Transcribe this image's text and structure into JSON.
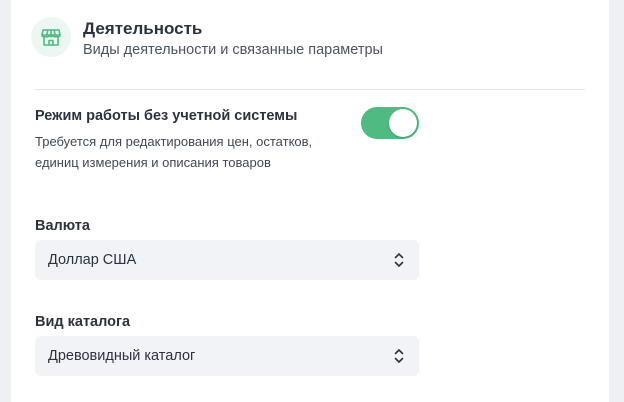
{
  "section": {
    "icon": "storefront-icon",
    "title": "Деятельность",
    "subtitle": "Виды деятельности и связанные параметры"
  },
  "mode": {
    "title": "Режим работы без учетной системы",
    "description": "Требуется для редактирования цен, остатков, единиц измерения и описания товаров",
    "enabled": true,
    "accent_color": "#4fba82"
  },
  "currency": {
    "label": "Валюта",
    "value": "Доллар США",
    "icon": "chevron-up-down-icon"
  },
  "catalog_type": {
    "label": "Вид каталога",
    "value": "Древовидный каталог",
    "icon": "chevron-up-down-icon"
  }
}
